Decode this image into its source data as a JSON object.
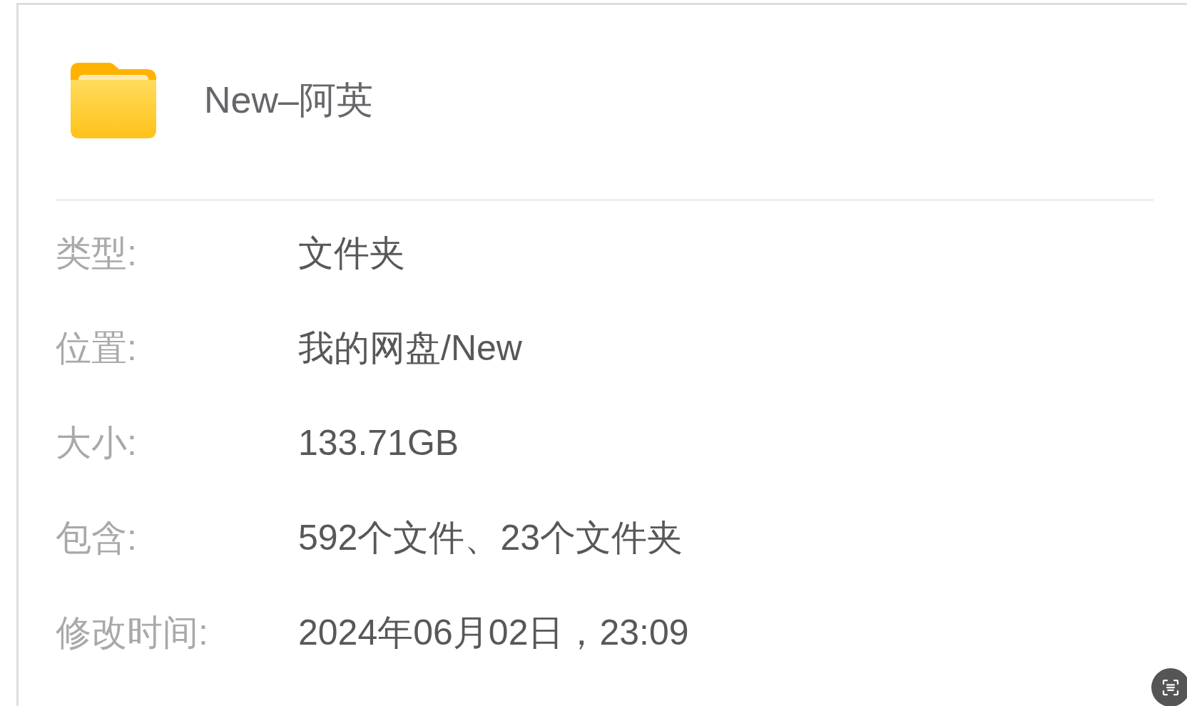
{
  "title": "New–阿英",
  "properties": [
    {
      "label": "类型:",
      "value": "文件夹"
    },
    {
      "label": "位置:",
      "value": "我的网盘/New"
    },
    {
      "label": "大小:",
      "value": "133.71GB"
    },
    {
      "label": "包含:",
      "value": "592个文件、23个文件夹"
    },
    {
      "label": "修改时间:",
      "value": "2024年06月02日，23:09"
    }
  ]
}
